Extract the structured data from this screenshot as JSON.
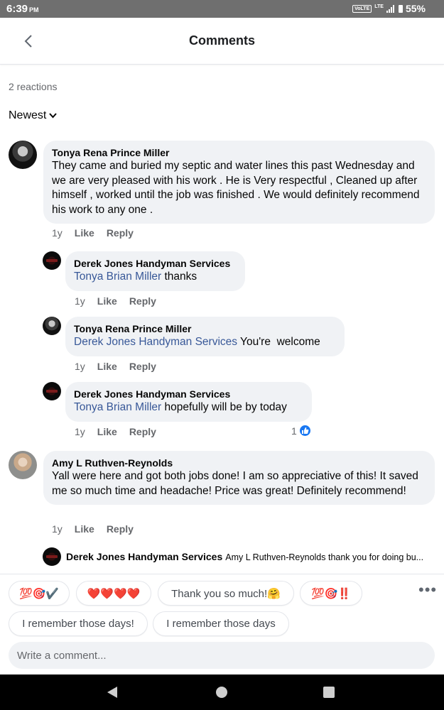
{
  "status_bar": {
    "time": "6:39",
    "ampm": "PM",
    "volte": "VoLTE",
    "lte": "LTE",
    "battery": "55%"
  },
  "header": {
    "title": "Comments",
    "back_icon": "chevron-left-icon"
  },
  "reactions": {
    "label": "2 reactions"
  },
  "sort": {
    "label": "Newest"
  },
  "comments": [
    {
      "author": "Tonya Rena Prince Miller",
      "text": "They came and buried my septic and water lines this past Wednesday and we are very pleased with his work . He is Very respectful , Cleaned up after himself , worked until the job was finished . We would definitely recommend his work to any one .",
      "age": "1y",
      "like": "Like",
      "reply": "Reply"
    },
    {
      "author": "Derek Jones Handyman Services",
      "mention": "Tonya Brian Miller",
      "text": " thanks",
      "age": "1y",
      "like": "Like",
      "reply": "Reply"
    },
    {
      "author": "Tonya Rena Prince Miller",
      "mention": "Derek Jones Handyman Services",
      "text": " You're  welcome",
      "age": "1y",
      "like": "Like",
      "reply": "Reply"
    },
    {
      "author": "Derek Jones Handyman Services",
      "mention": "Tonya Brian Miller",
      "text": " hopefully will be by today",
      "age": "1y",
      "like": "Like",
      "reply": "Reply",
      "like_count": "1"
    },
    {
      "author": "Amy L Ruthven-Reynolds",
      "text": "Yall were here and got both jobs done! I am so appreciative of this! It saved me so much time and headache! Price was great! Definitely recommend!",
      "age": "1y",
      "like": "Like",
      "reply": "Reply"
    },
    {
      "author": "Derek Jones Handyman Services",
      "snippet": "Amy L Ruthven-Reynolds thank you for doing bu..."
    }
  ],
  "quick_replies": [
    "💯🎯✔️",
    "❤️❤️❤️❤️",
    "Thank you so much!🤗",
    "💯🎯‼️",
    "I remember those days!",
    "I remember those days"
  ],
  "composer": {
    "placeholder": "Write a comment..."
  },
  "colors": {
    "mention": "#385898",
    "bubble": "#f0f2f5",
    "like_blue": "#1877f2"
  }
}
